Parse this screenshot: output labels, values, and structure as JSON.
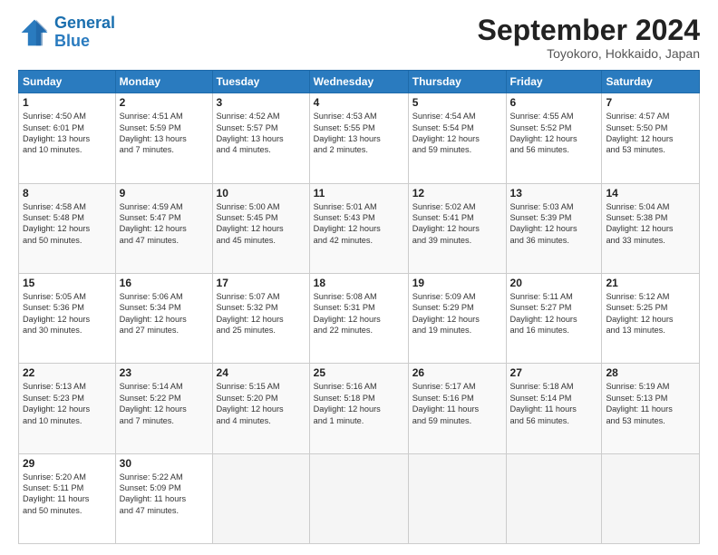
{
  "header": {
    "logo_general": "General",
    "logo_blue": "Blue",
    "month": "September 2024",
    "location": "Toyokoro, Hokkaido, Japan"
  },
  "weekdays": [
    "Sunday",
    "Monday",
    "Tuesday",
    "Wednesday",
    "Thursday",
    "Friday",
    "Saturday"
  ],
  "weeks": [
    [
      {
        "day": "1",
        "info": "Sunrise: 4:50 AM\nSunset: 6:01 PM\nDaylight: 13 hours\nand 10 minutes."
      },
      {
        "day": "2",
        "info": "Sunrise: 4:51 AM\nSunset: 5:59 PM\nDaylight: 13 hours\nand 7 minutes."
      },
      {
        "day": "3",
        "info": "Sunrise: 4:52 AM\nSunset: 5:57 PM\nDaylight: 13 hours\nand 4 minutes."
      },
      {
        "day": "4",
        "info": "Sunrise: 4:53 AM\nSunset: 5:55 PM\nDaylight: 13 hours\nand 2 minutes."
      },
      {
        "day": "5",
        "info": "Sunrise: 4:54 AM\nSunset: 5:54 PM\nDaylight: 12 hours\nand 59 minutes."
      },
      {
        "day": "6",
        "info": "Sunrise: 4:55 AM\nSunset: 5:52 PM\nDaylight: 12 hours\nand 56 minutes."
      },
      {
        "day": "7",
        "info": "Sunrise: 4:57 AM\nSunset: 5:50 PM\nDaylight: 12 hours\nand 53 minutes."
      }
    ],
    [
      {
        "day": "8",
        "info": "Sunrise: 4:58 AM\nSunset: 5:48 PM\nDaylight: 12 hours\nand 50 minutes."
      },
      {
        "day": "9",
        "info": "Sunrise: 4:59 AM\nSunset: 5:47 PM\nDaylight: 12 hours\nand 47 minutes."
      },
      {
        "day": "10",
        "info": "Sunrise: 5:00 AM\nSunset: 5:45 PM\nDaylight: 12 hours\nand 45 minutes."
      },
      {
        "day": "11",
        "info": "Sunrise: 5:01 AM\nSunset: 5:43 PM\nDaylight: 12 hours\nand 42 minutes."
      },
      {
        "day": "12",
        "info": "Sunrise: 5:02 AM\nSunset: 5:41 PM\nDaylight: 12 hours\nand 39 minutes."
      },
      {
        "day": "13",
        "info": "Sunrise: 5:03 AM\nSunset: 5:39 PM\nDaylight: 12 hours\nand 36 minutes."
      },
      {
        "day": "14",
        "info": "Sunrise: 5:04 AM\nSunset: 5:38 PM\nDaylight: 12 hours\nand 33 minutes."
      }
    ],
    [
      {
        "day": "15",
        "info": "Sunrise: 5:05 AM\nSunset: 5:36 PM\nDaylight: 12 hours\nand 30 minutes."
      },
      {
        "day": "16",
        "info": "Sunrise: 5:06 AM\nSunset: 5:34 PM\nDaylight: 12 hours\nand 27 minutes."
      },
      {
        "day": "17",
        "info": "Sunrise: 5:07 AM\nSunset: 5:32 PM\nDaylight: 12 hours\nand 25 minutes."
      },
      {
        "day": "18",
        "info": "Sunrise: 5:08 AM\nSunset: 5:31 PM\nDaylight: 12 hours\nand 22 minutes."
      },
      {
        "day": "19",
        "info": "Sunrise: 5:09 AM\nSunset: 5:29 PM\nDaylight: 12 hours\nand 19 minutes."
      },
      {
        "day": "20",
        "info": "Sunrise: 5:11 AM\nSunset: 5:27 PM\nDaylight: 12 hours\nand 16 minutes."
      },
      {
        "day": "21",
        "info": "Sunrise: 5:12 AM\nSunset: 5:25 PM\nDaylight: 12 hours\nand 13 minutes."
      }
    ],
    [
      {
        "day": "22",
        "info": "Sunrise: 5:13 AM\nSunset: 5:23 PM\nDaylight: 12 hours\nand 10 minutes."
      },
      {
        "day": "23",
        "info": "Sunrise: 5:14 AM\nSunset: 5:22 PM\nDaylight: 12 hours\nand 7 minutes."
      },
      {
        "day": "24",
        "info": "Sunrise: 5:15 AM\nSunset: 5:20 PM\nDaylight: 12 hours\nand 4 minutes."
      },
      {
        "day": "25",
        "info": "Sunrise: 5:16 AM\nSunset: 5:18 PM\nDaylight: 12 hours\nand 1 minute."
      },
      {
        "day": "26",
        "info": "Sunrise: 5:17 AM\nSunset: 5:16 PM\nDaylight: 11 hours\nand 59 minutes."
      },
      {
        "day": "27",
        "info": "Sunrise: 5:18 AM\nSunset: 5:14 PM\nDaylight: 11 hours\nand 56 minutes."
      },
      {
        "day": "28",
        "info": "Sunrise: 5:19 AM\nSunset: 5:13 PM\nDaylight: 11 hours\nand 53 minutes."
      }
    ],
    [
      {
        "day": "29",
        "info": "Sunrise: 5:20 AM\nSunset: 5:11 PM\nDaylight: 11 hours\nand 50 minutes."
      },
      {
        "day": "30",
        "info": "Sunrise: 5:22 AM\nSunset: 5:09 PM\nDaylight: 11 hours\nand 47 minutes."
      },
      {
        "day": "",
        "info": ""
      },
      {
        "day": "",
        "info": ""
      },
      {
        "day": "",
        "info": ""
      },
      {
        "day": "",
        "info": ""
      },
      {
        "day": "",
        "info": ""
      }
    ]
  ]
}
